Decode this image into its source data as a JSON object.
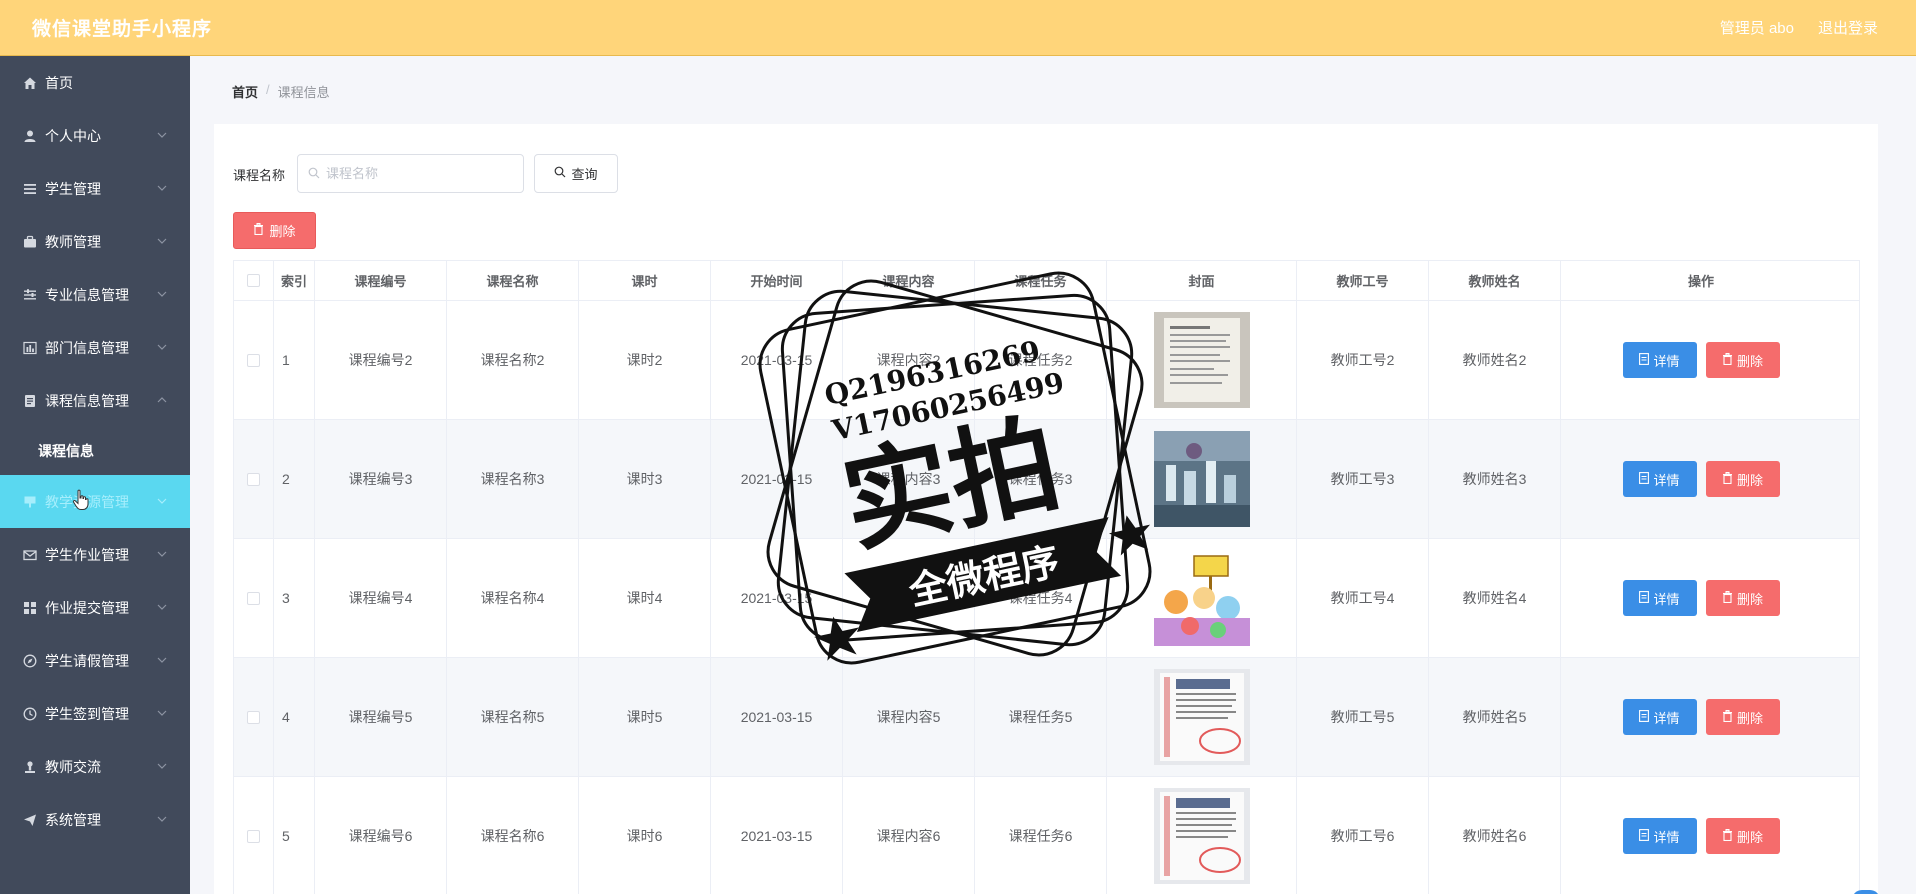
{
  "app": {
    "title": "微信课堂助手小程序",
    "user_label": "管理员 abo",
    "logout_label": "退出登录"
  },
  "sidebar": {
    "items": [
      {
        "label": "首页"
      },
      {
        "label": "个人中心"
      },
      {
        "label": "学生管理"
      },
      {
        "label": "教师管理"
      },
      {
        "label": "专业信息管理"
      },
      {
        "label": "部门信息管理"
      },
      {
        "label": "课程信息管理",
        "sub": "课程信息"
      },
      {
        "label": "教学... 管理",
        "full": "教学资源管理"
      },
      {
        "label": "学生作业管理"
      },
      {
        "label": "作业提交管理"
      },
      {
        "label": "学生请假管理"
      },
      {
        "label": "学生签到管理"
      },
      {
        "label": "教师交流"
      },
      {
        "label": "系统管理"
      }
    ],
    "sub_label": "课程信息",
    "active_label": "教学资源管理"
  },
  "breadcrumb": {
    "home": "首页",
    "sep": "/",
    "current": "课程信息"
  },
  "search": {
    "label": "课程名称",
    "placeholder": "课程名称",
    "query_label": "查询"
  },
  "bulk_delete_label": "删除",
  "table": {
    "headers": [
      "",
      "索引",
      "课程编号",
      "课程名称",
      "课时",
      "开始时间",
      "课程内容",
      "课程任务",
      "封面",
      "教师工号",
      "教师姓名",
      "操作"
    ],
    "detail_label": "详情",
    "delete_label": "删除",
    "rows": [
      {
        "idx": "1",
        "code": "课程编号2",
        "name": "课程名称2",
        "hours": "课时2",
        "start": "2021-03-15",
        "content": "课程内容2",
        "task": "课程任务2",
        "tno": "教师工号2",
        "tname": "教师姓名2"
      },
      {
        "idx": "2",
        "code": "课程编号3",
        "name": "课程名称3",
        "hours": "课时3",
        "start": "2021-03-15",
        "content": "课程内容3",
        "task": "课程任务3",
        "tno": "教师工号3",
        "tname": "教师姓名3"
      },
      {
        "idx": "3",
        "code": "课程编号4",
        "name": "课程名称4",
        "hours": "课时4",
        "start": "2021-03-15",
        "content": "课程内容4",
        "task": "课程任务4",
        "tno": "教师工号4",
        "tname": "教师姓名4"
      },
      {
        "idx": "4",
        "code": "课程编号5",
        "name": "课程名称5",
        "hours": "课时5",
        "start": "2021-03-15",
        "content": "课程内容5",
        "task": "课程任务5",
        "tno": "教师工号5",
        "tname": "教师姓名5"
      },
      {
        "idx": "5",
        "code": "课程编号6",
        "name": "课程名称6",
        "hours": "课时6",
        "start": "2021-03-15",
        "content": "课程内容6",
        "task": "课程任务6",
        "tno": "教师工号6",
        "tname": "教师姓名6"
      }
    ]
  },
  "watermark": {
    "line1": "Q2196316269",
    "line2": "V17060256499",
    "big": "实拍",
    "banner": "全微程序"
  },
  "colors": {
    "topbar": "#ffd57a",
    "sidebar": "#414a5b",
    "active": "#5ad8f0",
    "primary": "#3a8ee6",
    "danger": "#f56c6c"
  }
}
